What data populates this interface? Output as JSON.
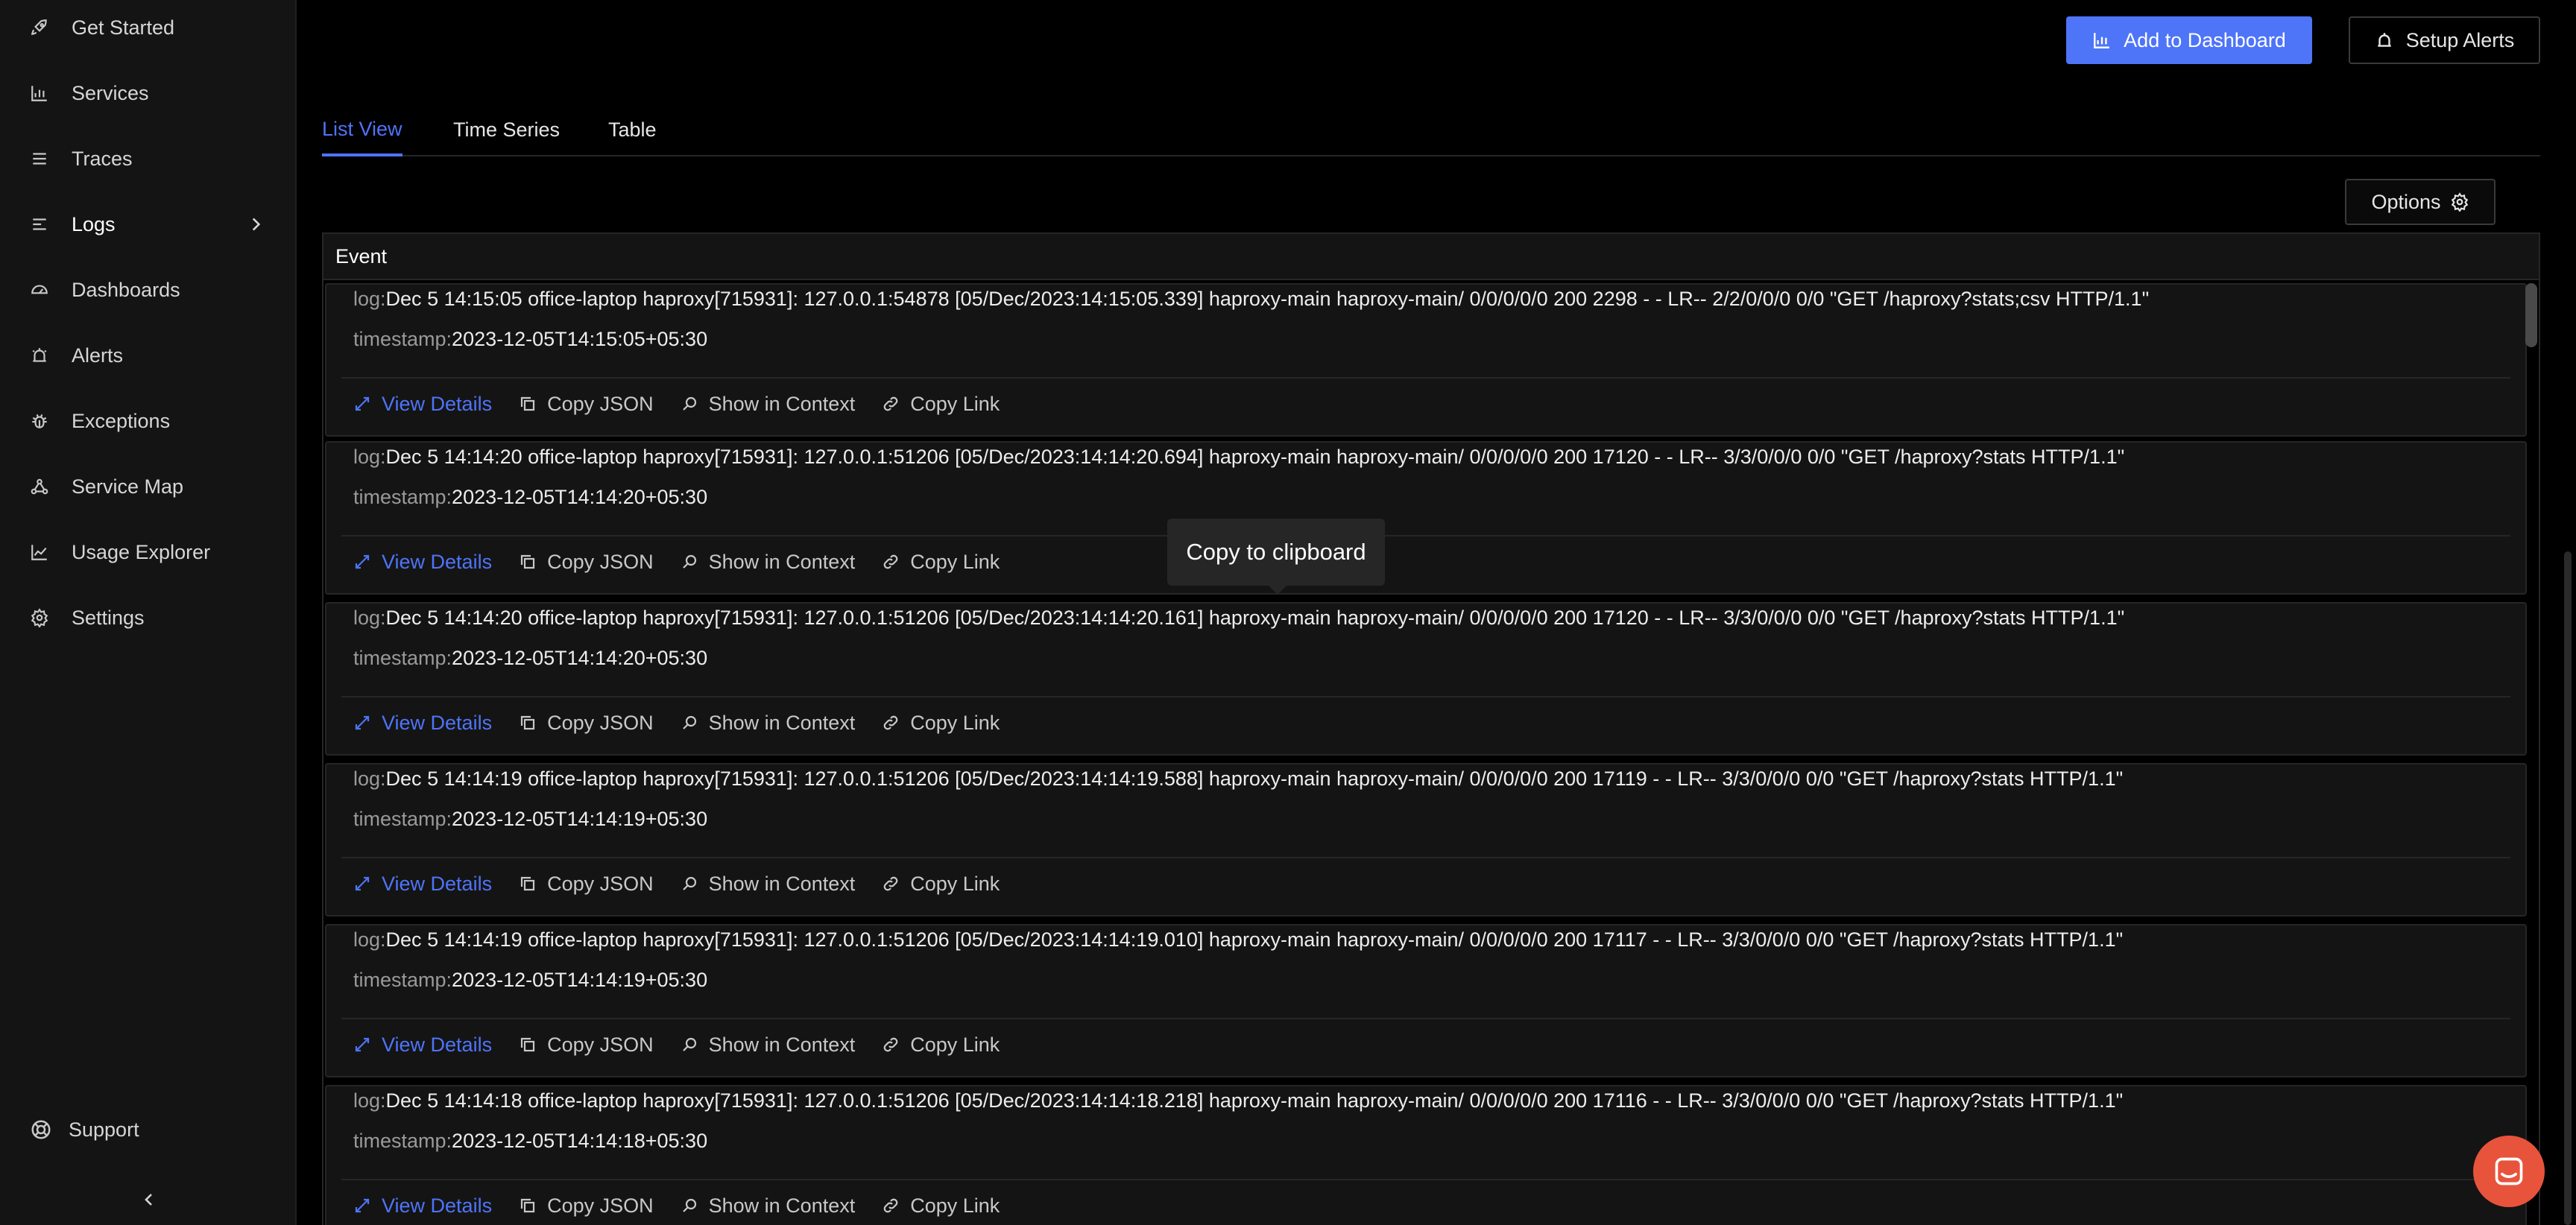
{
  "sidebar": {
    "items": [
      {
        "label": "Get Started",
        "icon": "rocket-icon"
      },
      {
        "label": "Services",
        "icon": "bar-chart-icon"
      },
      {
        "label": "Traces",
        "icon": "list-icon"
      },
      {
        "label": "Logs",
        "icon": "logs-icon"
      },
      {
        "label": "Dashboards",
        "icon": "dashboard-icon"
      },
      {
        "label": "Alerts",
        "icon": "alarm-icon"
      },
      {
        "label": "Exceptions",
        "icon": "bug-icon"
      },
      {
        "label": "Service Map",
        "icon": "service-map-icon"
      },
      {
        "label": "Usage Explorer",
        "icon": "line-chart-icon"
      },
      {
        "label": "Settings",
        "icon": "gear-icon"
      }
    ],
    "support_label": "Support"
  },
  "header": {
    "add_to_dashboard": "Add to Dashboard",
    "setup_alerts": "Setup Alerts"
  },
  "tabs": [
    {
      "label": "List View",
      "active": true
    },
    {
      "label": "Time Series",
      "active": false
    },
    {
      "label": "Table",
      "active": false
    }
  ],
  "options_label": "Options",
  "table": {
    "header": "Event",
    "log_key": "log:",
    "timestamp_key": "timestamp:",
    "actions": {
      "view_details": "View Details",
      "copy_json": "Copy JSON",
      "show_in_context": "Show in Context",
      "copy_link": "Copy Link"
    },
    "rows": [
      {
        "log": "Dec 5 14:15:05 office-laptop haproxy[715931]: 127.0.0.1:54878 [05/Dec/2023:14:15:05.339] haproxy-main haproxy-main/ 0/0/0/0/0 200 2298 - - LR-- 2/2/0/0/0 0/0 \"GET /haproxy?stats;csv HTTP/1.1\"",
        "timestamp": "2023-12-05T14:15:05+05:30"
      },
      {
        "log": "Dec 5 14:14:20 office-laptop haproxy[715931]: 127.0.0.1:51206 [05/Dec/2023:14:14:20.694] haproxy-main haproxy-main/ 0/0/0/0/0 200 17120 - - LR-- 3/3/0/0/0 0/0 \"GET /haproxy?stats HTTP/1.1\"",
        "timestamp": "2023-12-05T14:14:20+05:30"
      },
      {
        "log": "Dec 5 14:14:20 office-laptop haproxy[715931]: 127.0.0.1:51206 [05/Dec/2023:14:14:20.161] haproxy-main haproxy-main/ 0/0/0/0/0 200 17120 - - LR-- 3/3/0/0/0 0/0 \"GET /haproxy?stats HTTP/1.1\"",
        "timestamp": "2023-12-05T14:14:20+05:30"
      },
      {
        "log": "Dec 5 14:14:19 office-laptop haproxy[715931]: 127.0.0.1:51206 [05/Dec/2023:14:14:19.588] haproxy-main haproxy-main/ 0/0/0/0/0 200 17119 - - LR-- 3/3/0/0/0 0/0 \"GET /haproxy?stats HTTP/1.1\"",
        "timestamp": "2023-12-05T14:14:19+05:30"
      },
      {
        "log": "Dec 5 14:14:19 office-laptop haproxy[715931]: 127.0.0.1:51206 [05/Dec/2023:14:14:19.010] haproxy-main haproxy-main/ 0/0/0/0/0 200 17117 - - LR-- 3/3/0/0/0 0/0 \"GET /haproxy?stats HTTP/1.1\"",
        "timestamp": "2023-12-05T14:14:19+05:30"
      },
      {
        "log": "Dec 5 14:14:18 office-laptop haproxy[715931]: 127.0.0.1:51206 [05/Dec/2023:14:14:18.218] haproxy-main haproxy-main/ 0/0/0/0/0 200 17116 - - LR-- 3/3/0/0/0 0/0 \"GET /haproxy?stats HTTP/1.1\"",
        "timestamp": "2023-12-05T14:14:18+05:30"
      }
    ]
  },
  "tooltip": "Copy to clipboard",
  "colors": {
    "accent": "#4e74f8",
    "chat": "#e8533b"
  }
}
